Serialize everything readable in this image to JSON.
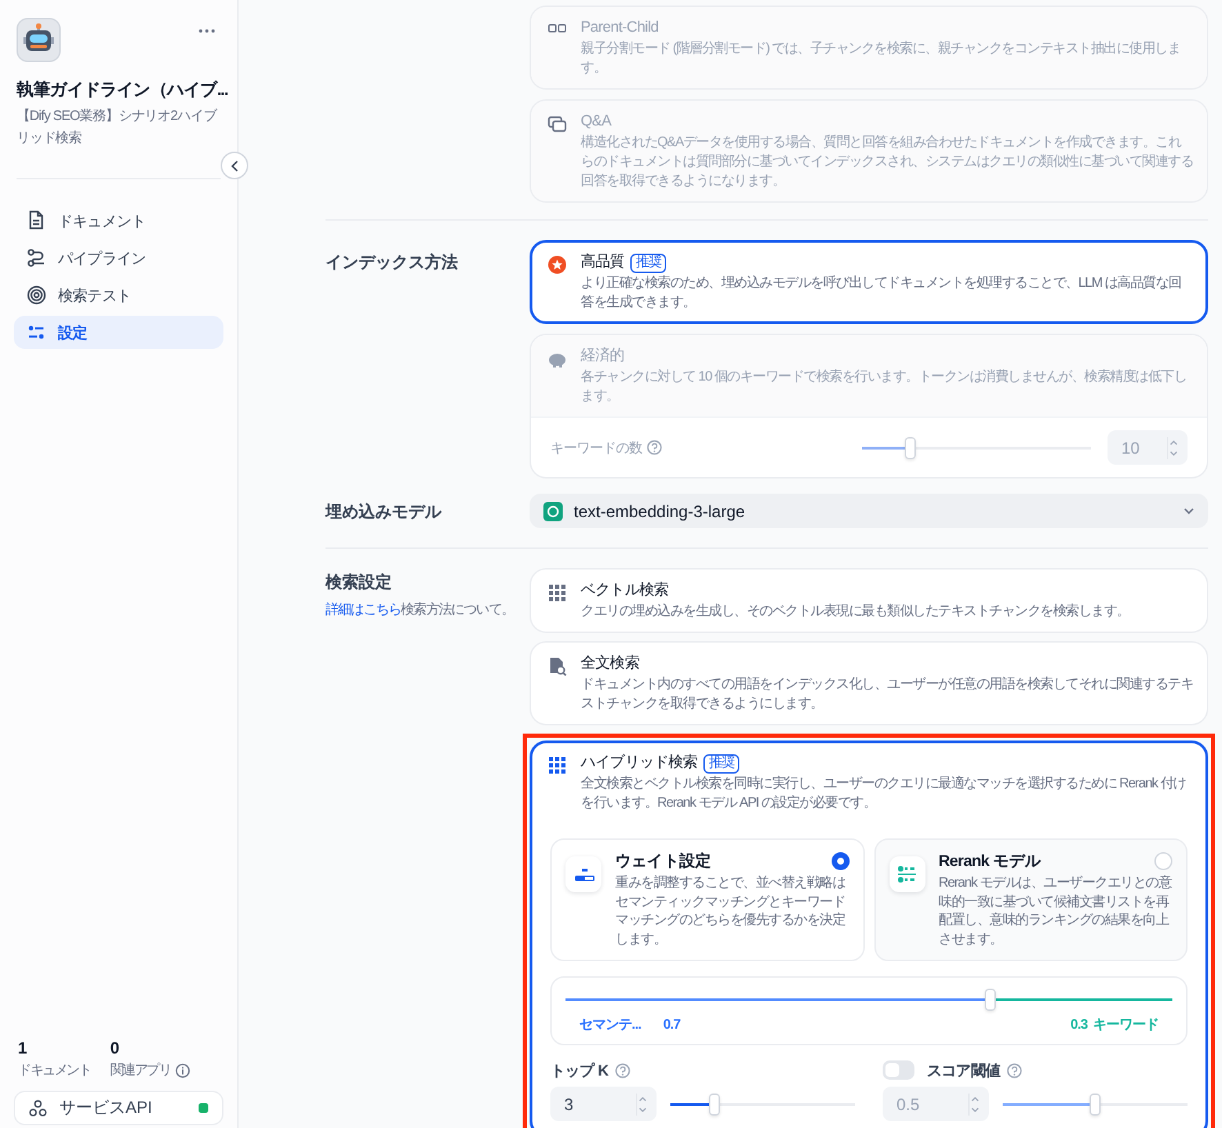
{
  "sidebar": {
    "title": "執筆ガイドライン（ハイブ...",
    "subtitle": "【Dify SEO業務】シナリオ2ハイブリッド検索",
    "nav": [
      {
        "label": "ドキュメント",
        "selected": false
      },
      {
        "label": "パイプライン",
        "selected": false
      },
      {
        "label": "検索テスト",
        "selected": false
      },
      {
        "label": "設定",
        "selected": true
      }
    ],
    "stats": [
      {
        "value": "1",
        "label": "ドキュメント",
        "info": false
      },
      {
        "value": "0",
        "label": "関連アプリ",
        "info": true
      }
    ],
    "service_api": {
      "label": "サービスAPI",
      "online": true
    }
  },
  "chunk_modes": [
    {
      "title": "Parent-Child",
      "description": "親子分割モード (階層分割モード) では、子チャンクを検索に、親チャンクをコンテキスト抽出に使用します。",
      "disabled": true
    },
    {
      "title": "Q&A",
      "description": "構造化されたQ&Aデータを使用する場合、質問と回答を組み合わせたドキュメントを作成できます。これらのドキュメントは質問部分に基づいてインデックスされ、システムはクエリの類似性に基づいて関連する回答を取得できるようになります。",
      "disabled": true
    }
  ],
  "index_method": {
    "label": "インデックス方法",
    "options": [
      {
        "title": "高品質",
        "badge": "推奨",
        "description": "より正確な検索のため、埋め込みモデルを呼び出してドキュメントを処理することで、LLM は高品質な回答を生成できます。",
        "selected": true,
        "disabled": false
      },
      {
        "title": "経済的",
        "description": "各チャンクに対して 10 個のキーワードで検索を行います。トークンは消費しませんが、検索精度は低下します。",
        "selected": false,
        "disabled": true,
        "keyword_count": {
          "label": "キーワードの数",
          "level": 0.21,
          "value": "10"
        }
      }
    ]
  },
  "embedding_model": {
    "label": "埋め込みモデル",
    "value": "text-embedding-3-large"
  },
  "retrieval": {
    "label": "検索設定",
    "link": "詳細はこちら",
    "link_suffix": "検索方法について。",
    "options": [
      {
        "title": "ベクトル検索",
        "description": "クエリの埋め込みを生成し、そのベクトル表現に最も類似したテキストチャンクを検索します。",
        "selected": false
      },
      {
        "title": "全文検索",
        "description": "ドキュメント内のすべての用語をインデックス化し、ユーザーが任意の用語を検索してそれに関連するテキストチャンクを取得できるようにします。",
        "selected": false
      },
      {
        "title": "ハイブリッド検索",
        "badge": "推奨",
        "description": "全文検索とベクトル検索を同時に実行し、ユーザーのクエリに最適なマッチを選択するために Rerank 付けを行います。Rerank モデル API の設定が必要です。",
        "selected": true
      }
    ],
    "hybrid": {
      "modes": [
        {
          "title": "ウェイト設定",
          "description": "重みを調整することで、並べ替え戦略はセマンティックマッチングとキーワードマッチングのどちらを優先するかを決定します。",
          "selected": true
        },
        {
          "title": "Rerank モデル",
          "description": "Rerank モデルは、ユーザークエリとの意味的一致に基づいて候補文書リストを再配置し、意味的ランキングの結果を向上させます。",
          "selected": false
        }
      ],
      "weight": {
        "semantic_label": "セマンテ...",
        "semantic_value": "0.7",
        "keyword_value": "0.3",
        "keyword_label": "キーワード",
        "level": 0.7
      },
      "top_k": {
        "label": "トップ K",
        "value": "3",
        "level": 0.24
      },
      "score_threshold": {
        "label": "スコア閾値",
        "enabled": false,
        "value": "0.5",
        "level": 0.5
      }
    }
  }
}
